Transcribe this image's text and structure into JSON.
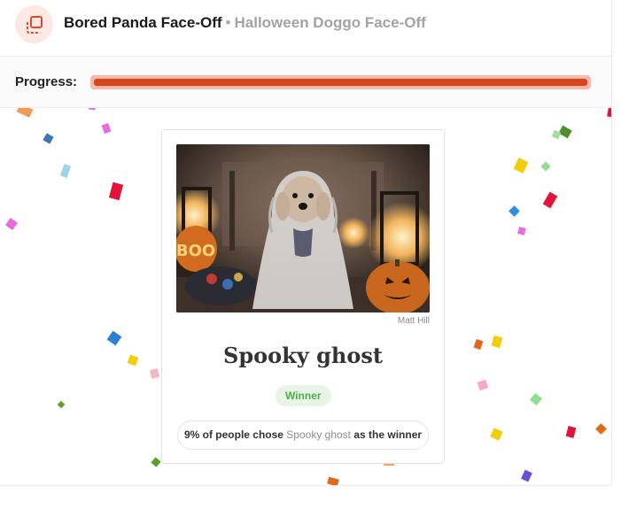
{
  "header": {
    "app_title": "Bored Panda Face-Off",
    "separator": "•",
    "subtitle": "Halloween Doggo Face-Off",
    "logo_icon": "face-off-logo-icon",
    "accent_color": "#e24a2c"
  },
  "progress": {
    "label": "Progress:",
    "value": 1.0,
    "fill_color": "#d6451e",
    "track_color": "#f6b8ad"
  },
  "result_card": {
    "image_credit": "Matt Hill",
    "title": "Spooky ghost",
    "badge": "Winner",
    "stat_prefix": "9% of people chose ",
    "stat_highlight": "Spooky ghost",
    "stat_suffix": " as the winner"
  }
}
